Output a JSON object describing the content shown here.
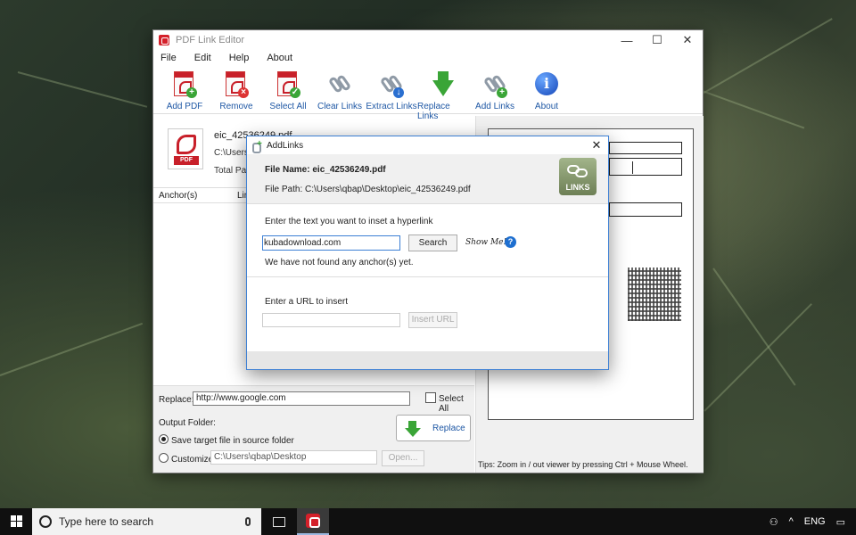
{
  "window": {
    "title": "PDF Link Editor",
    "controls": {
      "minimize": "—",
      "maximize": "☐",
      "close": "✕"
    }
  },
  "menu": [
    "File",
    "Edit",
    "Help",
    "About"
  ],
  "toolbar": [
    {
      "label": "Add PDF",
      "icon": "add-pdf-icon"
    },
    {
      "label": "Remove",
      "icon": "remove-pdf-icon"
    },
    {
      "label": "Select All",
      "icon": "select-all-icon"
    },
    {
      "label": "Clear Links",
      "icon": "clear-links-icon"
    },
    {
      "label": "Extract Links",
      "icon": "extract-links-icon"
    },
    {
      "label": "Replace Links",
      "icon": "replace-links-icon"
    },
    {
      "label": "Add Links",
      "icon": "add-links-icon"
    },
    {
      "label": "About",
      "icon": "about-icon"
    }
  ],
  "file": {
    "name": "eic_42536249.pdf",
    "path": "C:\\Users\\",
    "pages": "Total Pag"
  },
  "list": {
    "col1": "Anchor(s)",
    "col2": "Lin"
  },
  "bottom": {
    "replace_label": "Replace:",
    "replace_value": "http://www.google.com",
    "select_all": "Select All",
    "output_folder": "Output Folder:",
    "opt1": "Save target file in source folder",
    "opt2": "Customize:",
    "custom_path": "C:\\Users\\qbap\\Desktop",
    "open": "Open...",
    "replace_btn": "Replace"
  },
  "preview": {
    "tips": "Tips: Zoom in / out viewer by pressing Ctrl + Mouse Wheel."
  },
  "dialog": {
    "title": "AddLinks",
    "close": "✕",
    "file_name": "File Name: eic_42536249.pdf",
    "file_path": "File Path: C:\\Users\\qbap\\Desktop\\eic_42536249.pdf",
    "links_badge": "LINKS",
    "prompt_text": "Enter the text you want to inset a hyperlink",
    "keyword_value": "kubadownload.com",
    "search_btn": "Search",
    "show_me": "Show Me!",
    "help": "?",
    "status": "We have not found any anchor(s) yet.",
    "prompt_url": "Enter a URL to insert",
    "url_value": "",
    "insert_btn": "Insert URL"
  },
  "taskbar": {
    "search_placeholder": "Type here to search",
    "language": "ENG"
  }
}
